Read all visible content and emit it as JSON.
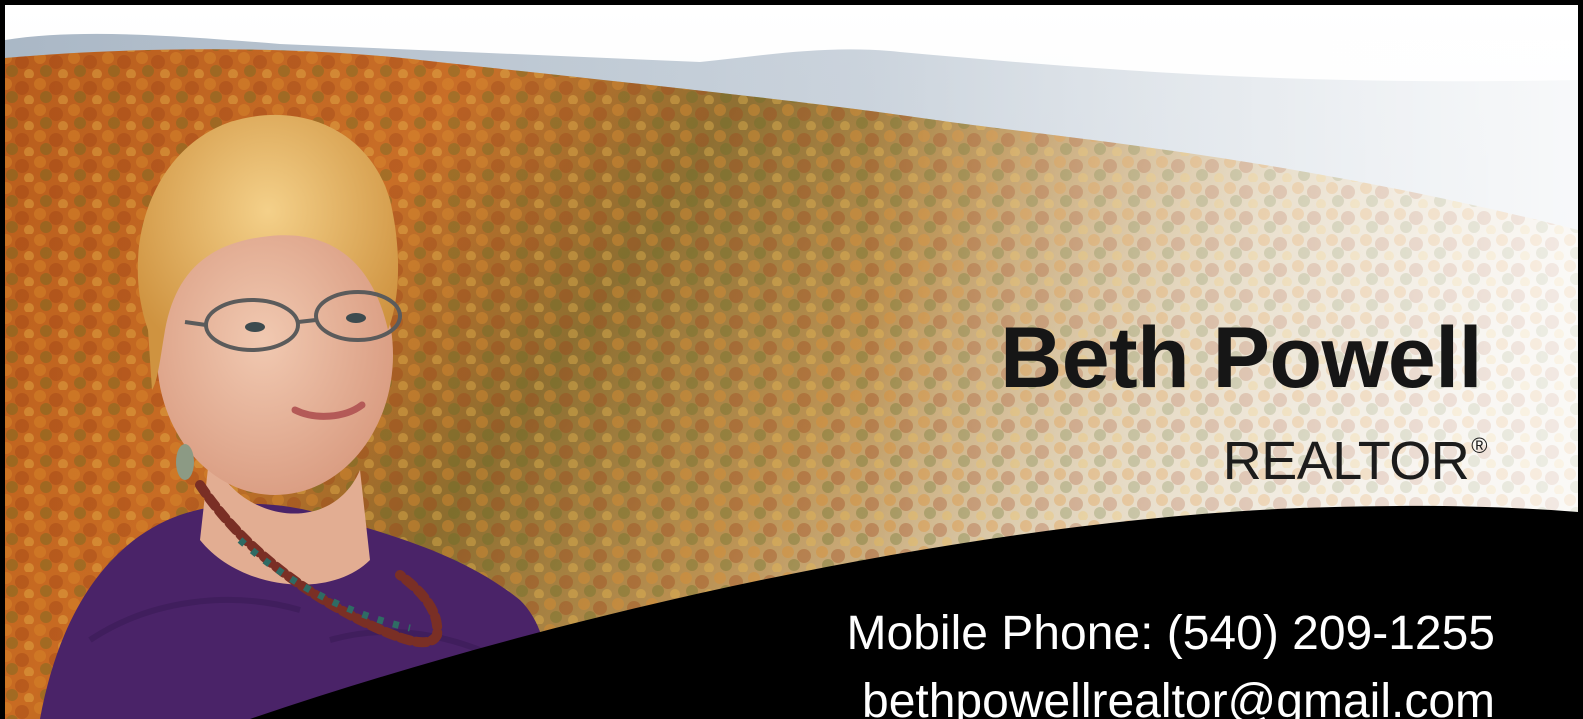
{
  "card": {
    "name": "Beth Powell",
    "title": "REALTOR",
    "title_mark": "®",
    "phone": "Mobile Phone: (540) 209-1255",
    "email": "bethpowellrealtor@gmail.com"
  },
  "colors": {
    "frame": "#000000",
    "band": "#000000",
    "name_text": "#161616",
    "contact_text": "#ffffff",
    "sky": "#f3f5f7",
    "forest_orange": "#c9651e",
    "forest_gold": "#d9a23a",
    "forest_green": "#5d6b2a",
    "shirt": "#4a2368",
    "hair": "#e3b25f"
  }
}
